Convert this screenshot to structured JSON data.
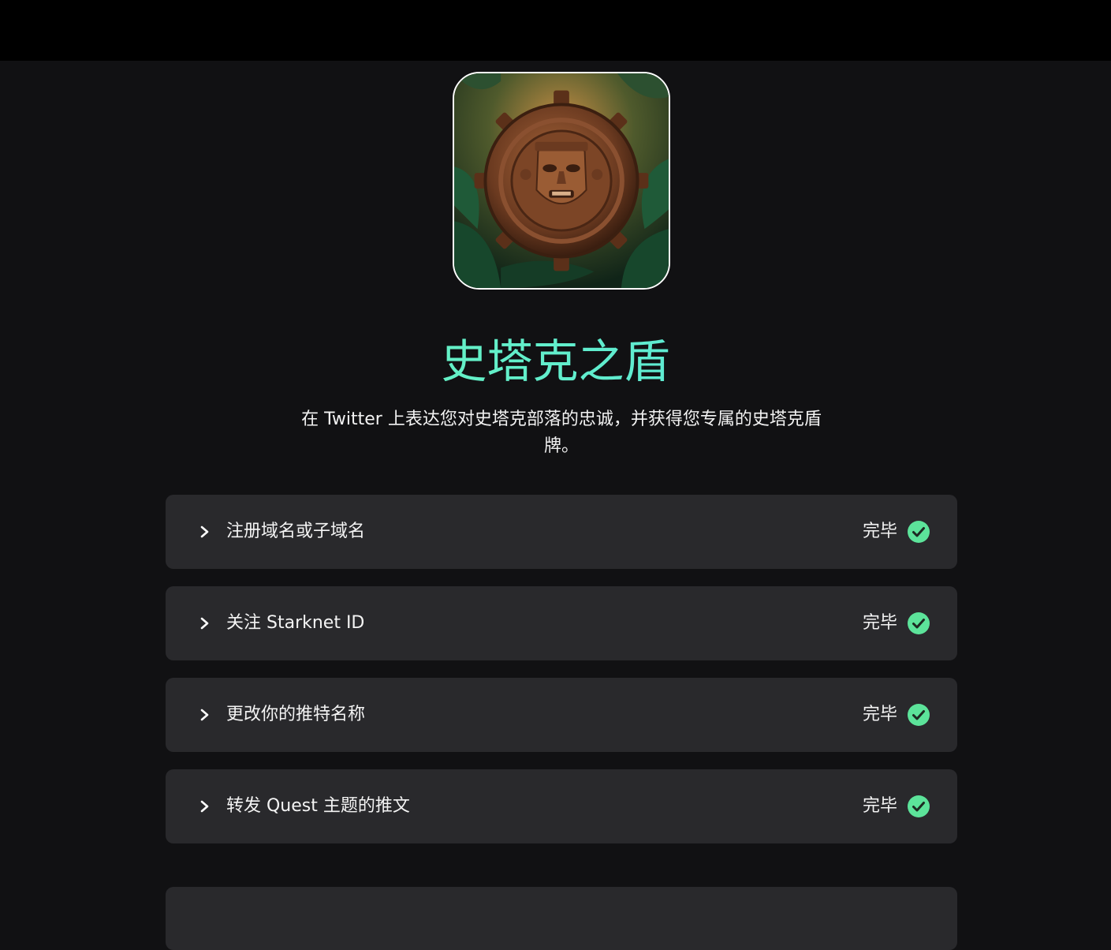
{
  "quest": {
    "title": "史塔克之盾",
    "description": "在 Twitter 上表达您对史塔克部落的忠诚，并获得您专属的史塔克盾牌。",
    "image_icon": "aztec-shield-icon"
  },
  "tasks": [
    {
      "label": "注册域名或子域名",
      "status": "完毕",
      "completed": true
    },
    {
      "label": "关注 Starknet ID",
      "status": "完毕",
      "completed": true
    },
    {
      "label": "更改你的推特名称",
      "status": "完毕",
      "completed": true
    },
    {
      "label": "转发 Quest 主题的推文",
      "status": "完毕",
      "completed": true
    }
  ],
  "colors": {
    "background": "#111113",
    "topbar": "#000000",
    "card": "#29292c",
    "title_gradient_start": "#6ffcb0",
    "title_gradient_end": "#54e0e8",
    "check_green": "#5ce39a"
  }
}
